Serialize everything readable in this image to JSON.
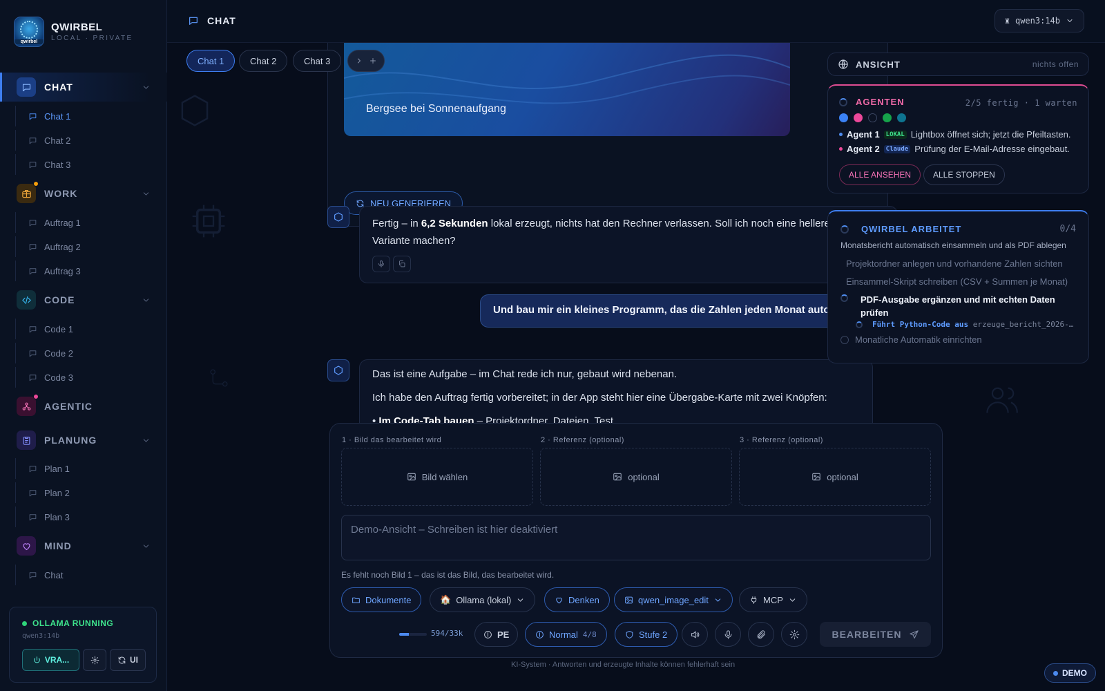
{
  "brand": {
    "name": "QWIRBEL",
    "sub": "LOCAL · PRIVATE",
    "logo_text": "qwirbel"
  },
  "sidebar": {
    "sections": [
      {
        "label": "CHAT",
        "items": [
          "Chat 1",
          "Chat 2",
          "Chat 3"
        ]
      },
      {
        "label": "WORK",
        "items": [
          "Auftrag 1",
          "Auftrag 2",
          "Auftrag 3"
        ]
      },
      {
        "label": "CODE",
        "items": [
          "Code 1",
          "Code 2",
          "Code 3"
        ]
      },
      {
        "label": "AGENTIC",
        "items": []
      },
      {
        "label": "PLANUNG",
        "items": [
          "Plan 1",
          "Plan 2",
          "Plan 3"
        ]
      },
      {
        "label": "MIND",
        "items": [
          "Chat"
        ]
      }
    ],
    "status": {
      "label": "OLLAMA RUNNING",
      "model": "qwen3:14b",
      "vra_label": "VRA...",
      "ui_label": "UI"
    }
  },
  "header": {
    "title": "CHAT",
    "model": "qwen3:14b"
  },
  "tabs": [
    "Chat 1",
    "Chat 2",
    "Chat 3"
  ],
  "chat": {
    "image_caption": "Bergsee bei Sonnenaufgang",
    "regen_label": "NEU GENERIEREN",
    "msg1": {
      "pre": "Fertig – in ",
      "bold": "6,2 Sekunden",
      "post": " lokal erzeugt, nichts hat den Rechner verlassen. Soll ich noch eine hellere",
      "line2": "Variante machen?"
    },
    "user_msg": "Und bau mir ein kleines Programm, das die Zahlen jeden Monat automatisch",
    "msg2": {
      "line1": "Das ist eine Aufgabe – im Chat rede ich nur, gebaut wird nebenan.",
      "line2": "Ich habe den Auftrag fertig vorbereitet; in der App steht hier eine Übergabe-Karte mit zwei Knöpfen:",
      "line3_bold": "Im Code-Tab bauen",
      "line3_rest": " – Projektordner, Dateien, Test"
    }
  },
  "view_panel": {
    "label": "ANSICHT",
    "state": "nichts offen"
  },
  "agents": {
    "title": "AGENTEN",
    "count": "2/5 fertig · 1 warten",
    "dot_colors": [
      "#3b82f6",
      "#ec4899",
      "#0b1223",
      "#16a34a",
      "#0e7490"
    ],
    "rows": [
      {
        "name": "Agent 1",
        "tag": "LOKAL",
        "text": "Lightbox öffnet sich; jetzt die Pfeiltasten."
      },
      {
        "name": "Agent 2",
        "tag": "Claude",
        "text": "Prüfung der E-Mail-Adresse eingebaut."
      }
    ],
    "view_all": "ALLE ANSEHEN",
    "stop_all": "ALLE STOPPEN"
  },
  "work": {
    "title": "QWIRBEL ARBEITET",
    "count": "0/4",
    "subtitle": "Monatsbericht automatisch einsammeln und als PDF ablegen",
    "steps": [
      "Projektordner anlegen und vorhandene Zahlen sichten",
      "Einsammel-Skript schreiben (CSV + Summen je Monat)"
    ],
    "current_step_l1": "PDF-Ausgabe ergänzen und mit echten Daten",
    "current_step_l2": "prüfen",
    "action": "Führt Python-Code aus",
    "action_arg": "erzeuge_bericht_2026-…",
    "next_step": "Monatliche Automatik einrichten"
  },
  "composer": {
    "slot_labels": [
      "1 · Bild das bearbeitet wird",
      "2 · Referenz (optional)",
      "3 · Referenz (optional)"
    ],
    "slot_texts": [
      "Bild wählen",
      "optional",
      "optional"
    ],
    "placeholder": "Demo-Ansicht – Schreiben ist hier deaktiviert",
    "hint": "Es fehlt noch Bild 1 – das ist das Bild, das bearbeitet wird.",
    "buttons": {
      "docs": "Dokumente",
      "provider": "Ollama (lokal)",
      "think": "Denken",
      "tool": "qwen_image_edit",
      "mcp": "MCP",
      "pe": "PE",
      "mode": "Normal",
      "mode_count": "4/8",
      "level": "Stufe 2",
      "send": "BEARBEITEN"
    },
    "context": "594/33k",
    "context_fill": 0.018
  },
  "footer": "KI-System · Antworten und erzeugte Inhalte können fehlerhaft sein",
  "demo_badge": "DEMO",
  "colors": {
    "accent": "#3e7ef0",
    "agents": "#e04d93",
    "ok": "#2fd47a"
  }
}
